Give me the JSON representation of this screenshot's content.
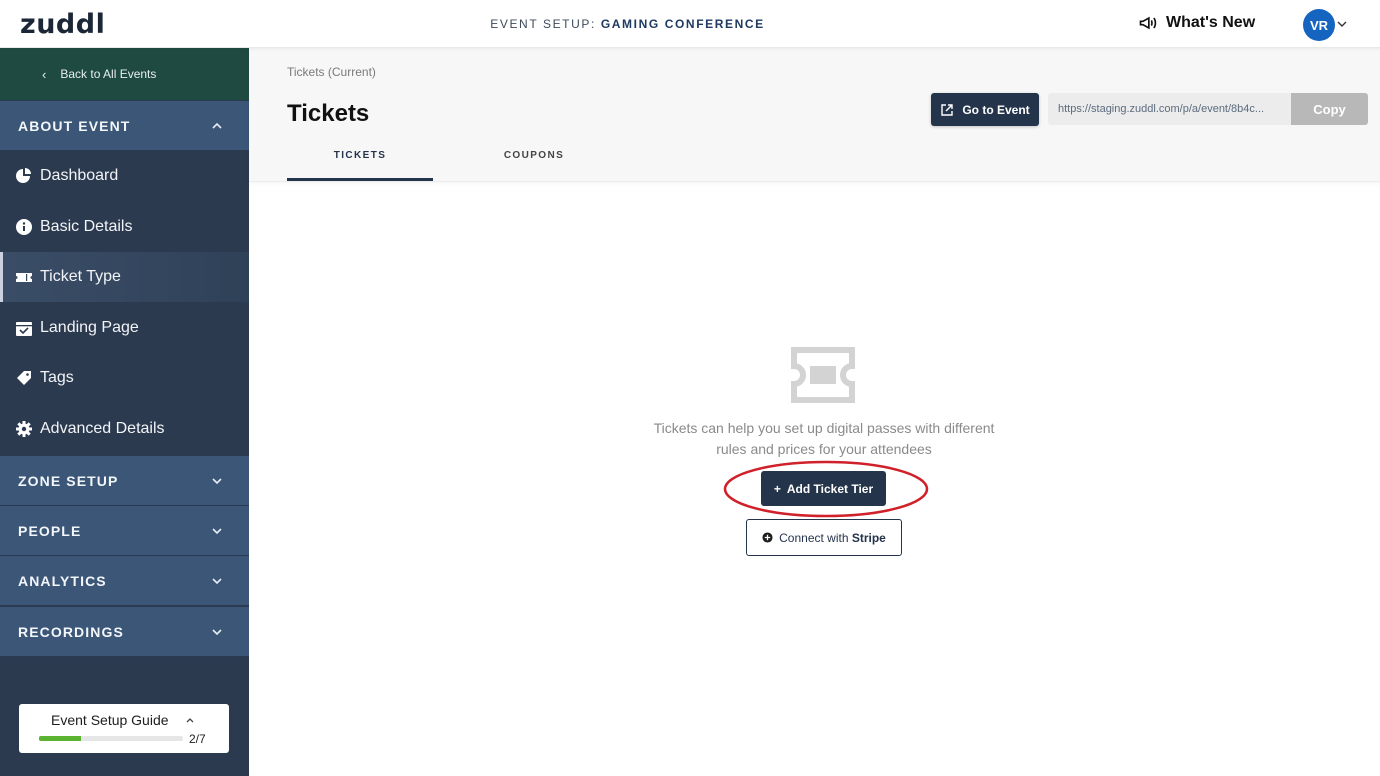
{
  "header": {
    "logo": "zuddl",
    "event_prefix": "EVENT SETUP: ",
    "event_name": "GAMING CONFERENCE",
    "whats_new": "What's New",
    "avatar_initials": "VR"
  },
  "sidebar": {
    "back_label": "Back to All Events",
    "about_section": "ABOUT EVENT",
    "items": [
      {
        "label": "Dashboard",
        "icon": "pie-chart-icon"
      },
      {
        "label": "Basic Details",
        "icon": "info-icon"
      },
      {
        "label": "Ticket Type",
        "icon": "ticket-icon",
        "active": true
      },
      {
        "label": "Landing Page",
        "icon": "calendar-check-icon"
      },
      {
        "label": "Tags",
        "icon": "tag-icon"
      },
      {
        "label": "Advanced Details",
        "icon": "gear-icon"
      }
    ],
    "sections": [
      "ZONE SETUP",
      "PEOPLE",
      "ANALYTICS",
      "RECORDINGS"
    ],
    "guide": {
      "title": "Event Setup Guide",
      "count": "2/7",
      "progress": 0.29
    }
  },
  "main": {
    "breadcrumb": "Tickets (Current)",
    "title": "Tickets",
    "go_to_event": "Go to Event",
    "url": "https://staging.zuddl.com/p/a/event/8b4c...",
    "copy": "Copy",
    "tabs": [
      {
        "label": "TICKETS",
        "active": true
      },
      {
        "label": "COUPONS",
        "active": false
      }
    ],
    "empty_text": "Tickets can help you set up digital passes with different rules and prices for your attendees",
    "add_tier": "Add Ticket Tier",
    "stripe_prefix": "Connect with ",
    "stripe_brand": "Stripe"
  },
  "colors": {
    "sidebar_bg": "#2b3a4f",
    "section_bg": "#3b5677",
    "back_bg": "#1f4a42",
    "primary": "#24344a",
    "avatar": "#1565c0",
    "highlight": "#d0202a",
    "progress": "#5bb332"
  }
}
